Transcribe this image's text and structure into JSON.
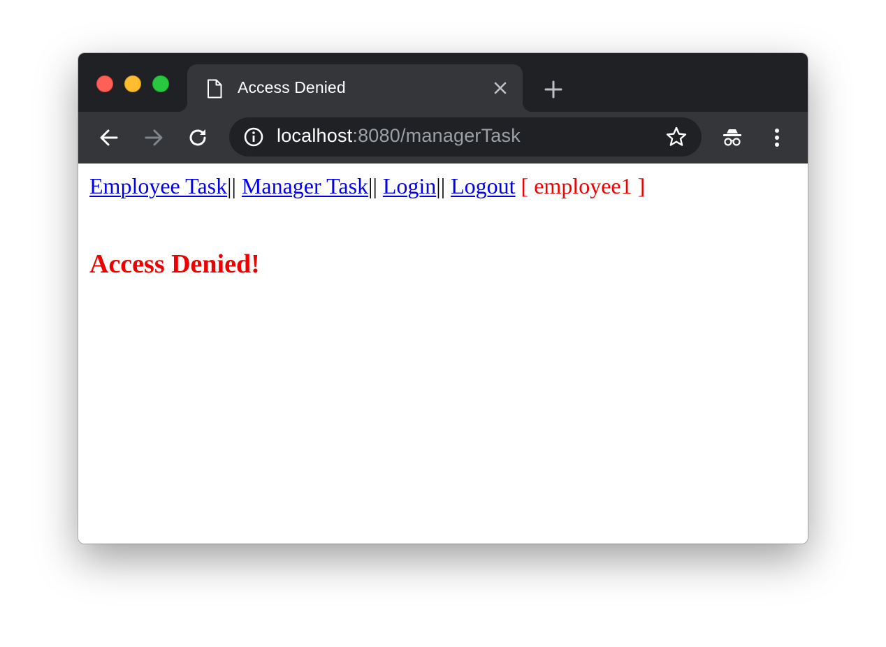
{
  "browser": {
    "tab": {
      "title": "Access Denied",
      "icon": "page-icon",
      "close_icon": "close-icon"
    },
    "new_tab_icon": "plus-icon",
    "toolbar": {
      "back_icon": "arrow-left-icon",
      "forward_icon": "arrow-right-icon",
      "reload_icon": "reload-icon",
      "incognito_icon": "incognito-icon",
      "menu_icon": "kebab-menu-icon"
    },
    "omnibox": {
      "info_icon": "info-icon",
      "host": "localhost",
      "path": ":8080/managerTask",
      "star_icon": "star-icon"
    },
    "colors": {
      "titlebar": "#202124",
      "toolbar": "#35363a",
      "omnibox": "#202124"
    }
  },
  "page": {
    "nav": {
      "employee_task": "Employee Task",
      "sep1": "||",
      "manager_task": "Manager Task",
      "sep2": "||",
      "login": "Login",
      "sep3": "||",
      "logout": "Logout",
      "user": "[ employee1 ]"
    },
    "message": "Access Denied!",
    "colors": {
      "link": "#0000ee",
      "error": "#ee0000"
    }
  }
}
